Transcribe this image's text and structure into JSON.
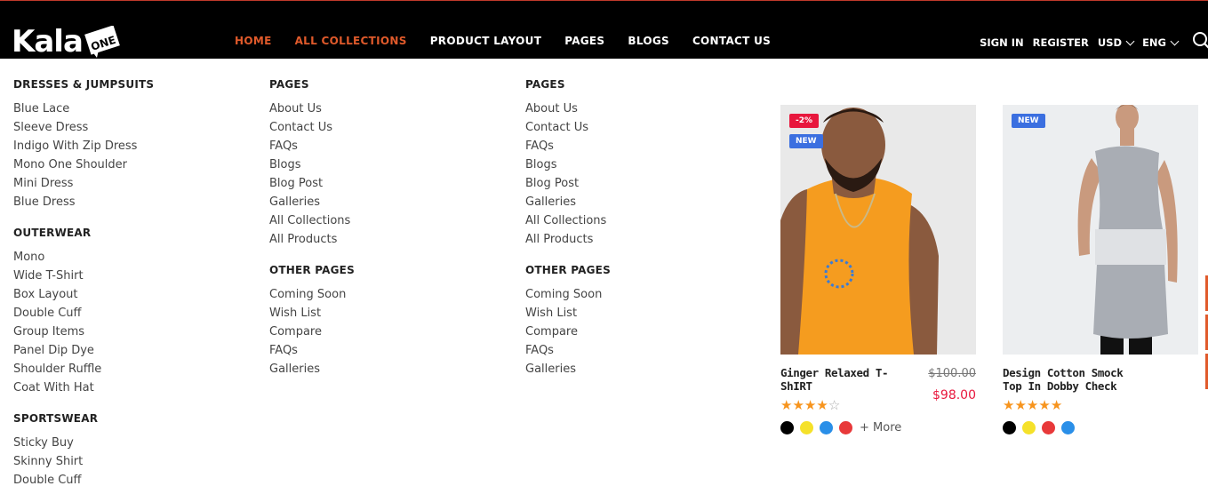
{
  "logo": {
    "text": "Kala",
    "badge_text": "ONE"
  },
  "nav": {
    "items": [
      "HOME",
      "ALL COLLECTIONS",
      "PRODUCT LAYOUT",
      "PAGES",
      "BLOGS",
      "CONTACT US"
    ]
  },
  "account": {
    "sign_in": "SIGN IN",
    "register": "REGISTER",
    "currency": "USD",
    "language": "ENG"
  },
  "menu": {
    "col1": [
      {
        "heading": "DRESSES & JUMPSUITS",
        "items": [
          "Blue Lace",
          "Sleeve Dress",
          "Indigo With Zip Dress",
          "Mono One Shoulder",
          "Mini Dress",
          "Blue Dress"
        ]
      },
      {
        "heading": "OUTERWEAR",
        "items": [
          "Mono",
          "Wide T-Shirt",
          "Box Layout",
          "Double Cuff",
          "Group Items",
          "Panel Dip Dye",
          "Shoulder Ruffle",
          "Coat With Hat"
        ]
      },
      {
        "heading": "SPORTSWEAR",
        "items": [
          "Sticky Buy",
          "Skinny Shirt",
          "Double Cuff"
        ]
      }
    ],
    "col2": [
      {
        "heading": "PAGES",
        "items": [
          "About Us",
          "Contact Us",
          "FAQs",
          "Blogs",
          "Blog Post",
          "Galleries",
          "All Collections",
          "All Products"
        ]
      },
      {
        "heading": "OTHER PAGES",
        "items": [
          "Coming Soon",
          "Wish List",
          "Compare",
          "FAQs",
          "Galleries"
        ]
      }
    ],
    "col3": [
      {
        "heading": "PAGES",
        "items": [
          "About Us",
          "Contact Us",
          "FAQs",
          "Blogs",
          "Blog Post",
          "Galleries",
          "All Collections",
          "All Products"
        ]
      },
      {
        "heading": "OTHER PAGES",
        "items": [
          "Coming Soon",
          "Wish List",
          "Compare",
          "FAQs",
          "Galleries"
        ]
      }
    ]
  },
  "products": [
    {
      "title": "Ginger Relaxed T-ShIRT",
      "old_price": "$100.00",
      "price": "$98.00",
      "rating": 4,
      "badges": [
        "-2%",
        "NEW"
      ],
      "swatches": [
        "#000000",
        "#f5e12a",
        "#2a8fe8",
        "#e8393a"
      ],
      "more_label": "+ More",
      "image_colors": {
        "bg": "#e9e9e9",
        "shirt": "#f59c1f",
        "skin": "#8a5a3e"
      }
    },
    {
      "title": "Design Cotton Smock Top In Dobby Check",
      "rating": 5,
      "badges": [
        "NEW"
      ],
      "swatches": [
        "#000000",
        "#f5e12a",
        "#e8393a",
        "#2a8fe8"
      ],
      "image_colors": {
        "bg": "#eceef0",
        "shirt": "#a9adb4",
        "skin": "#c99a7e"
      }
    }
  ],
  "colors": {
    "accent": "#e05a2b",
    "sale": "#e8173d",
    "new": "#3b6fe0",
    "star": "#f7941d"
  }
}
